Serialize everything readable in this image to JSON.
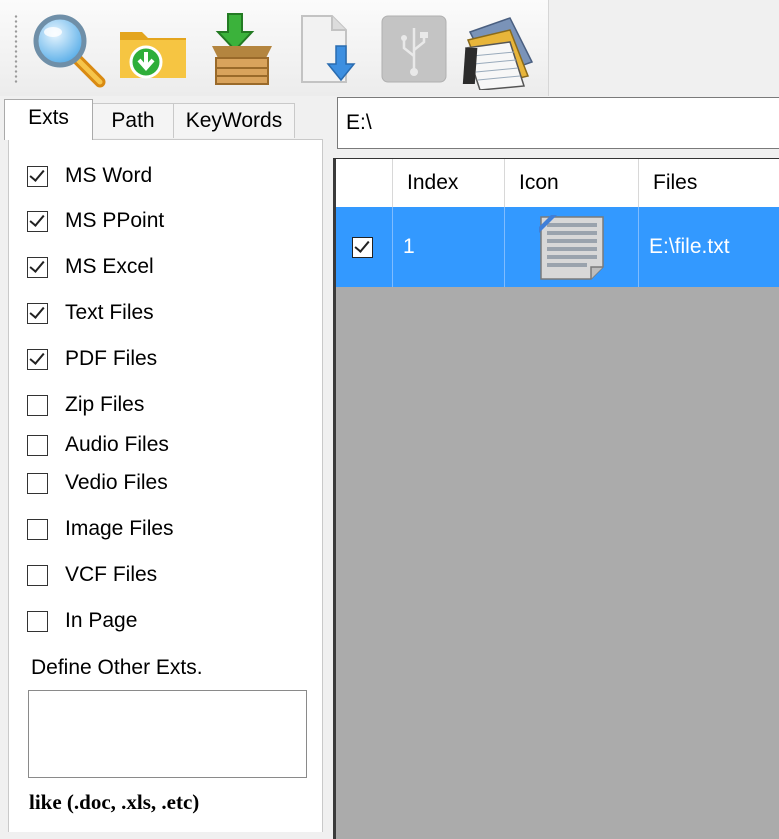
{
  "toolbar": {
    "buttons": [
      {
        "icon": "magnifier-icon"
      },
      {
        "icon": "folder-download-icon"
      },
      {
        "icon": "box-download-icon"
      },
      {
        "icon": "file-download-icon"
      },
      {
        "icon": "usb-icon"
      },
      {
        "icon": "cards-icon"
      }
    ]
  },
  "tabs": [
    {
      "label": "Exts",
      "active": true
    },
    {
      "label": "Path",
      "active": false
    },
    {
      "label": "KeyWords",
      "active": false
    }
  ],
  "exts": {
    "options": [
      {
        "label": "MS Word",
        "checked": true
      },
      {
        "label": "MS PPoint",
        "checked": true
      },
      {
        "label": "MS Excel",
        "checked": true
      },
      {
        "label": "Text Files",
        "checked": true
      },
      {
        "label": "PDF Files",
        "checked": true
      },
      {
        "label": "Zip Files",
        "checked": false
      },
      {
        "label": "Audio Files",
        "checked": false
      },
      {
        "label": "Vedio Files",
        "checked": false
      },
      {
        "label": "Image Files",
        "checked": false
      },
      {
        "label": "VCF Files",
        "checked": false
      },
      {
        "label": "In Page",
        "checked": false
      }
    ],
    "define_label": "Define Other Exts.",
    "define_value": "",
    "hint": "like (.doc, .xls, .etc)"
  },
  "path": {
    "value": "E:\\"
  },
  "grid": {
    "columns": [
      "",
      "Index",
      "Icon",
      "Files"
    ],
    "rows": [
      {
        "checked": true,
        "index": "1",
        "icon": "text-file-icon",
        "file": "E:\\file.txt",
        "selected": true
      }
    ]
  },
  "colors": {
    "selection": "#3399ff",
    "grid_background": "#ababab"
  }
}
